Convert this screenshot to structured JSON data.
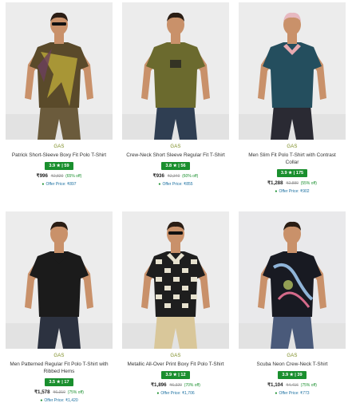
{
  "products": [
    {
      "brand": "GAS",
      "name": "Patrick Short-Sleeve Boxy Fit Polo T-Shirt",
      "rating": "3.9 ★ | 59",
      "price": "₹996",
      "mrp": "₹2,820",
      "off": "(65% off)",
      "offer": "Offer Price: ₹897",
      "image": "polo-camo-shirt",
      "colors": {
        "shirt": "#5a4a2a",
        "accent": "#b6a338",
        "pants": "#6b5b3c"
      }
    },
    {
      "brand": "GAS",
      "name": "Crew-Neck Short Sleeve Regular Fit T-Shirt",
      "rating": "3.8 ★ | 56",
      "price": "₹936",
      "mrp": "₹2,340",
      "off": "(60% off)",
      "offer": "Offer Price: ₹855",
      "image": "olive-tshirt",
      "colors": {
        "shirt": "#6b6a2e",
        "accent": "#7a7830",
        "pants": "#2f3e52"
      }
    },
    {
      "brand": "GAS",
      "name": "Men Slim Fit Polo T-Shirt with Contrast Collar",
      "rating": "3.9 ★ | 175",
      "price": "₹1,288",
      "mrp": "₹2,880",
      "off": "(55% off)",
      "offer": "Offer Price: ₹902",
      "image": "teal-polo",
      "colors": {
        "shirt": "#244e5e",
        "accent": "#e8a9b0",
        "pants": "#2a2a33"
      }
    },
    {
      "brand": "GAS",
      "name": "Men Patterned Regular Fit Polo T-Shirt with Ribbed Hems",
      "rating": "3.5 ★ | 17",
      "price": "₹1,578",
      "mrp": "₹6,310",
      "off": "(75% off)",
      "offer": "Offer Price: ₹1,420",
      "image": "black-polo",
      "colors": {
        "shirt": "#1b1b1b",
        "accent": "#2a2a2a",
        "pants": "#2c3240"
      }
    },
    {
      "brand": "GAS",
      "name": "Metallic All-Over Print Boxy Fit Polo T-Shirt",
      "rating": "3.9 ★ | 12",
      "price": "₹1,896",
      "mrp": "₹6,320",
      "off": "(70% off)",
      "offer": "Offer Price: ₹1,706",
      "image": "geometric-polo",
      "colors": {
        "shirt": "#1e1e1e",
        "accent": "#e7e2cf",
        "pants": "#d9c79a"
      }
    },
    {
      "brand": "GAS",
      "name": "Scuba Neon Crew-Neck T-Shirt",
      "rating": "3.9 ★ | 39",
      "price": "₹1,104",
      "mrp": "₹4,416",
      "off": "(75% off)",
      "offer": "Offer Price: ₹773",
      "image": "print-tshirt",
      "colors": {
        "shirt": "#181a22",
        "accent": "#8fb4d8",
        "pants": "#4a5a7a"
      }
    }
  ]
}
